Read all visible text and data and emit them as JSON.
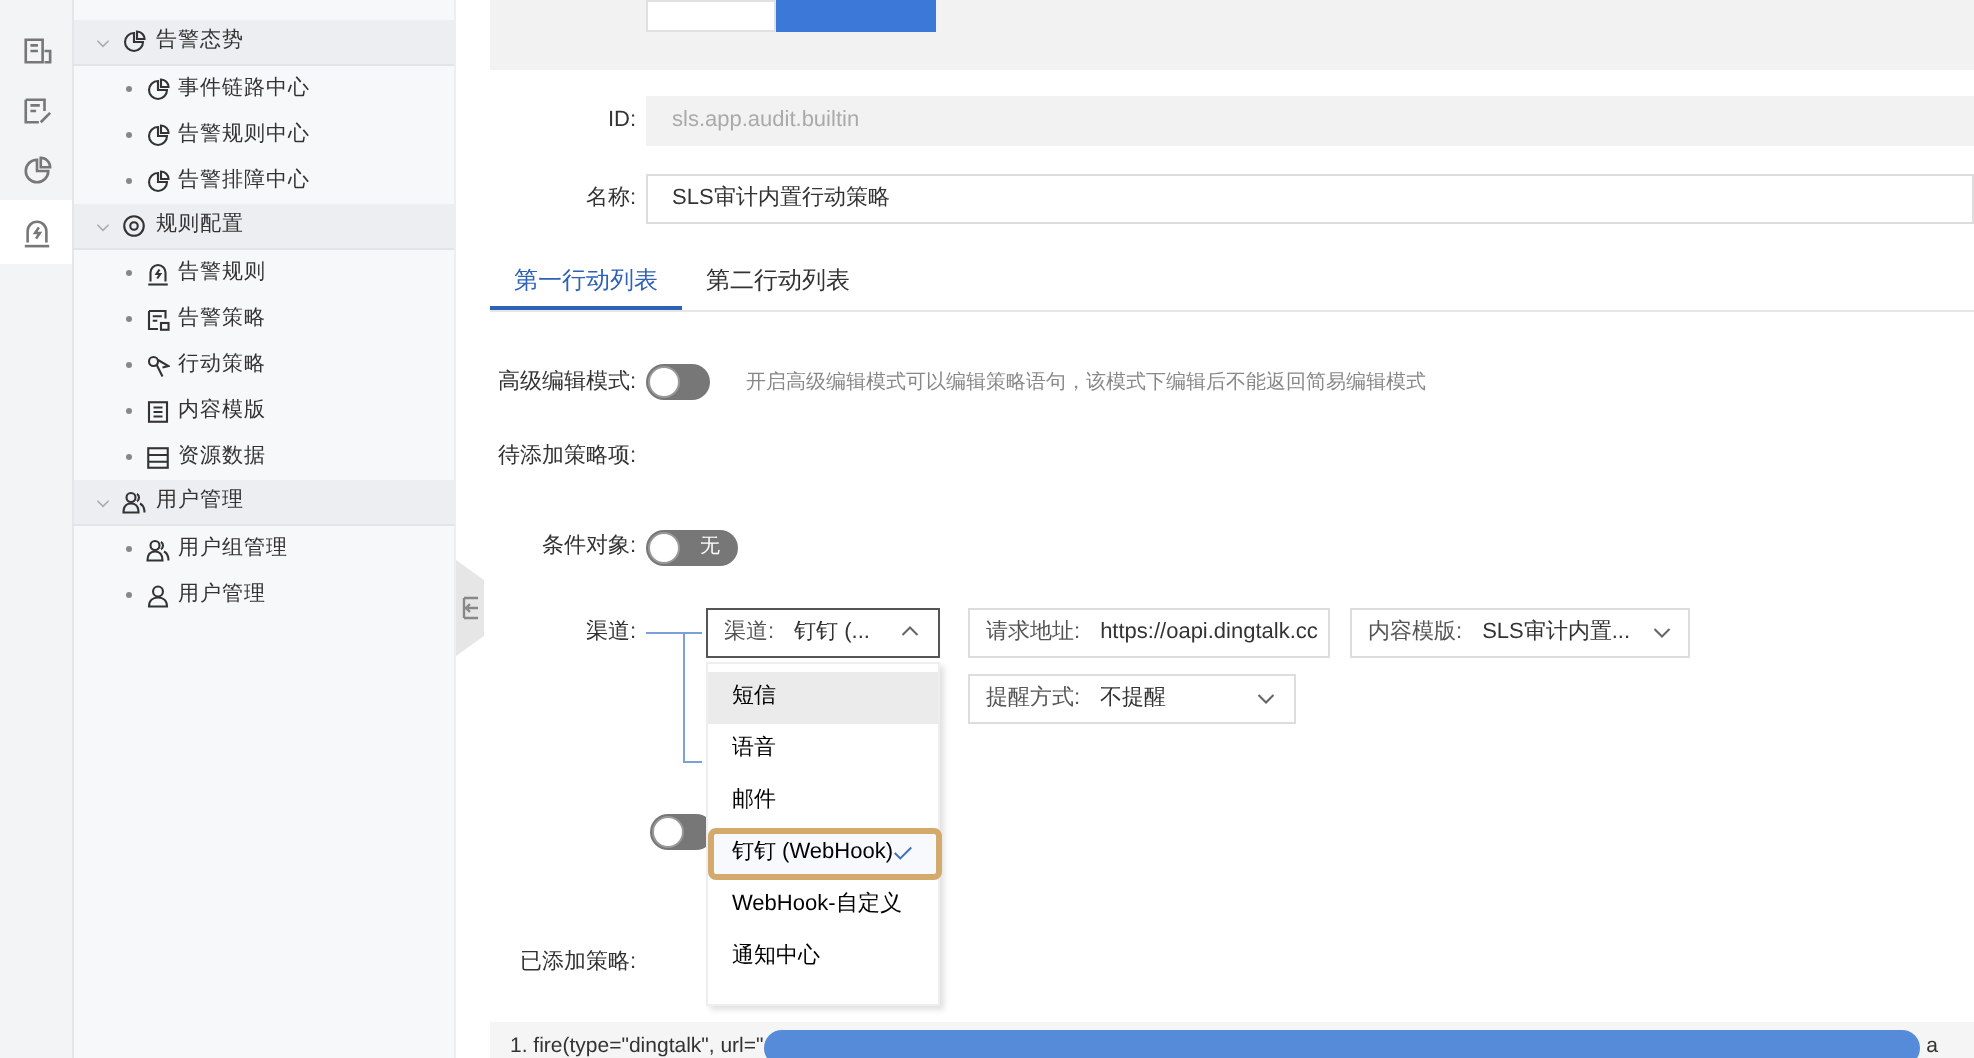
{
  "rail": [
    {
      "selected": false
    },
    {
      "selected": false
    },
    {
      "selected": false
    },
    {
      "selected": true
    }
  ],
  "sidebar": [
    {
      "label": "告警态势",
      "expanded": true,
      "children": [
        {
          "label": "事件链路中心"
        },
        {
          "label": "告警规则中心"
        },
        {
          "label": "告警排障中心"
        }
      ]
    },
    {
      "label": "规则配置",
      "expanded": true,
      "children": [
        {
          "label": "告警规则"
        },
        {
          "label": "告警策略"
        },
        {
          "label": "行动策略"
        },
        {
          "label": "内容模版"
        },
        {
          "label": "资源数据"
        }
      ]
    },
    {
      "label": "用户管理",
      "expanded": true,
      "children": [
        {
          "label": "用户组管理"
        },
        {
          "label": "用户管理"
        }
      ]
    }
  ],
  "top_segments": [
    {
      "selected": false
    },
    {
      "selected": true
    }
  ],
  "id_field": {
    "label": "ID:",
    "value": "sls.app.audit.builtin",
    "disabled": true
  },
  "name_field": {
    "label": "名称:",
    "value": "SLS审计内置行动策略",
    "disabled": false
  },
  "tabs": [
    {
      "label": "第一行动列表",
      "selected": true
    },
    {
      "label": "第二行动列表",
      "selected": false
    }
  ],
  "advanced_mode": {
    "label": "高级编辑模式:",
    "on": false,
    "hint": "开启高级编辑模式可以编辑策略语句，该模式下编辑后不能返回简易编辑模式"
  },
  "pending_label": "待添加策略项:",
  "condition": {
    "label": "条件对象:",
    "on": false,
    "toggle_text": "无"
  },
  "channel": {
    "label": "渠道:",
    "select": {
      "prefix": "渠道:",
      "value": "钉钉 (...",
      "expanded": true
    },
    "request_url": {
      "label": "请求地址:",
      "value": "https://oapi.dingtalk.cc"
    },
    "template": {
      "label": "内容模版:",
      "value": "SLS审计内置..."
    },
    "remind": {
      "label": "提醒方式:",
      "value": "不提醒"
    },
    "options": [
      {
        "label": "短信",
        "selected": false,
        "hovered": true
      },
      {
        "label": "语音",
        "selected": false,
        "hovered": false
      },
      {
        "label": "邮件",
        "selected": false,
        "hovered": false
      },
      {
        "label": "钉钉 (WebHook)",
        "selected": true,
        "hovered": false
      },
      {
        "label": "WebHook-自定义",
        "selected": false,
        "hovered": false
      },
      {
        "label": "通知中心",
        "selected": false,
        "hovered": false
      }
    ]
  },
  "extra_toggle": {
    "on": false
  },
  "added_label": "已添加策略:",
  "code_line": {
    "text": "1. fire(type=\"dingtalk\", url=\"",
    "tail": "a"
  }
}
